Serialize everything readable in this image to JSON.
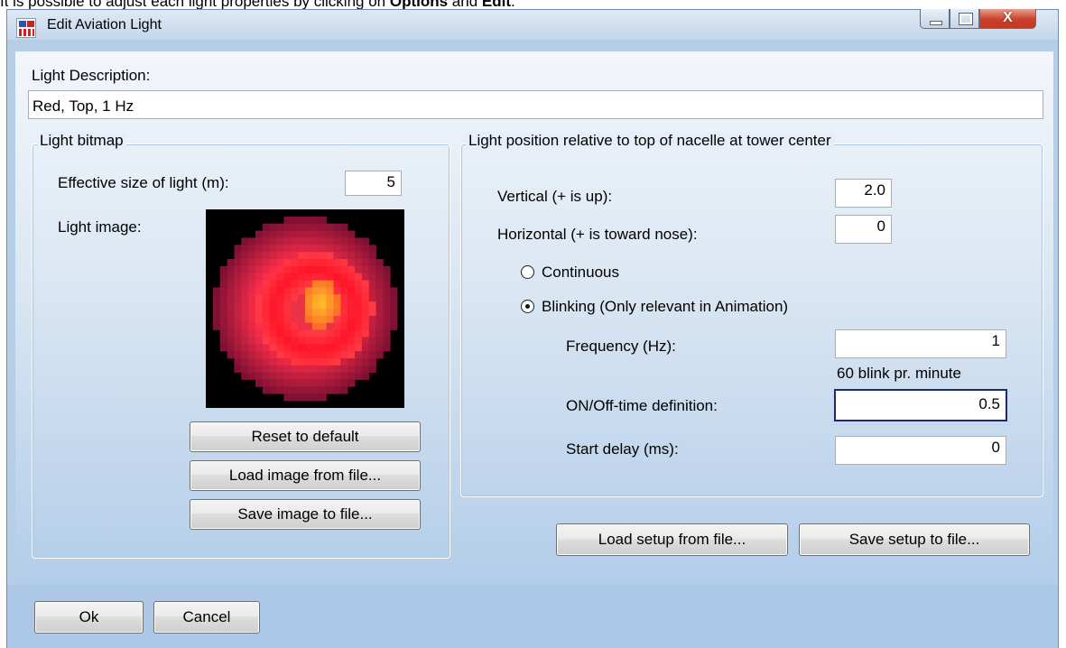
{
  "caption": {
    "text_before": "It is possible to adjust each light properties by clicking on ",
    "bold_1": "Options",
    "text_middle": " and ",
    "bold_2": "Edit",
    "text_after": "."
  },
  "window": {
    "title": "Edit Aviation Light",
    "close_glyph": "X"
  },
  "description": {
    "label": "Light Description:",
    "value": "Red, Top, 1 Hz"
  },
  "light_bitmap": {
    "group_title": "Light bitmap",
    "effective_size_label": "Effective size of light (m):",
    "effective_size_value": "5",
    "image_label": "Light image:",
    "reset_button": "Reset to default",
    "load_image_button": "Load image from file...",
    "save_image_button": "Save image to file..."
  },
  "position": {
    "group_title": "Light position relative to top of nacelle at tower center",
    "vertical_label": "Vertical (+ is up):",
    "vertical_value": "2.0",
    "horizontal_label": "Horizontal (+ is toward nose):",
    "horizontal_value": "0",
    "continuous_label": "Continuous",
    "blinking_label": "Blinking (Only relevant in Animation)",
    "selected_mode": "blinking",
    "frequency_label": "Frequency (Hz):",
    "frequency_value": "1",
    "blink_rate_text": "60 blink pr. minute",
    "onoff_label": "ON/Off-time definition:",
    "onoff_value": "0.5",
    "start_delay_label": "Start delay (ms):",
    "start_delay_value": "0"
  },
  "setup_buttons": {
    "load": "Load setup from file...",
    "save": "Save setup to file..."
  },
  "footer": {
    "ok": "Ok",
    "cancel": "Cancel"
  },
  "colors": {
    "light_core": "#ffb020",
    "light_mid": "#ff2030",
    "light_outer": "#a01030",
    "background": "#000000"
  }
}
